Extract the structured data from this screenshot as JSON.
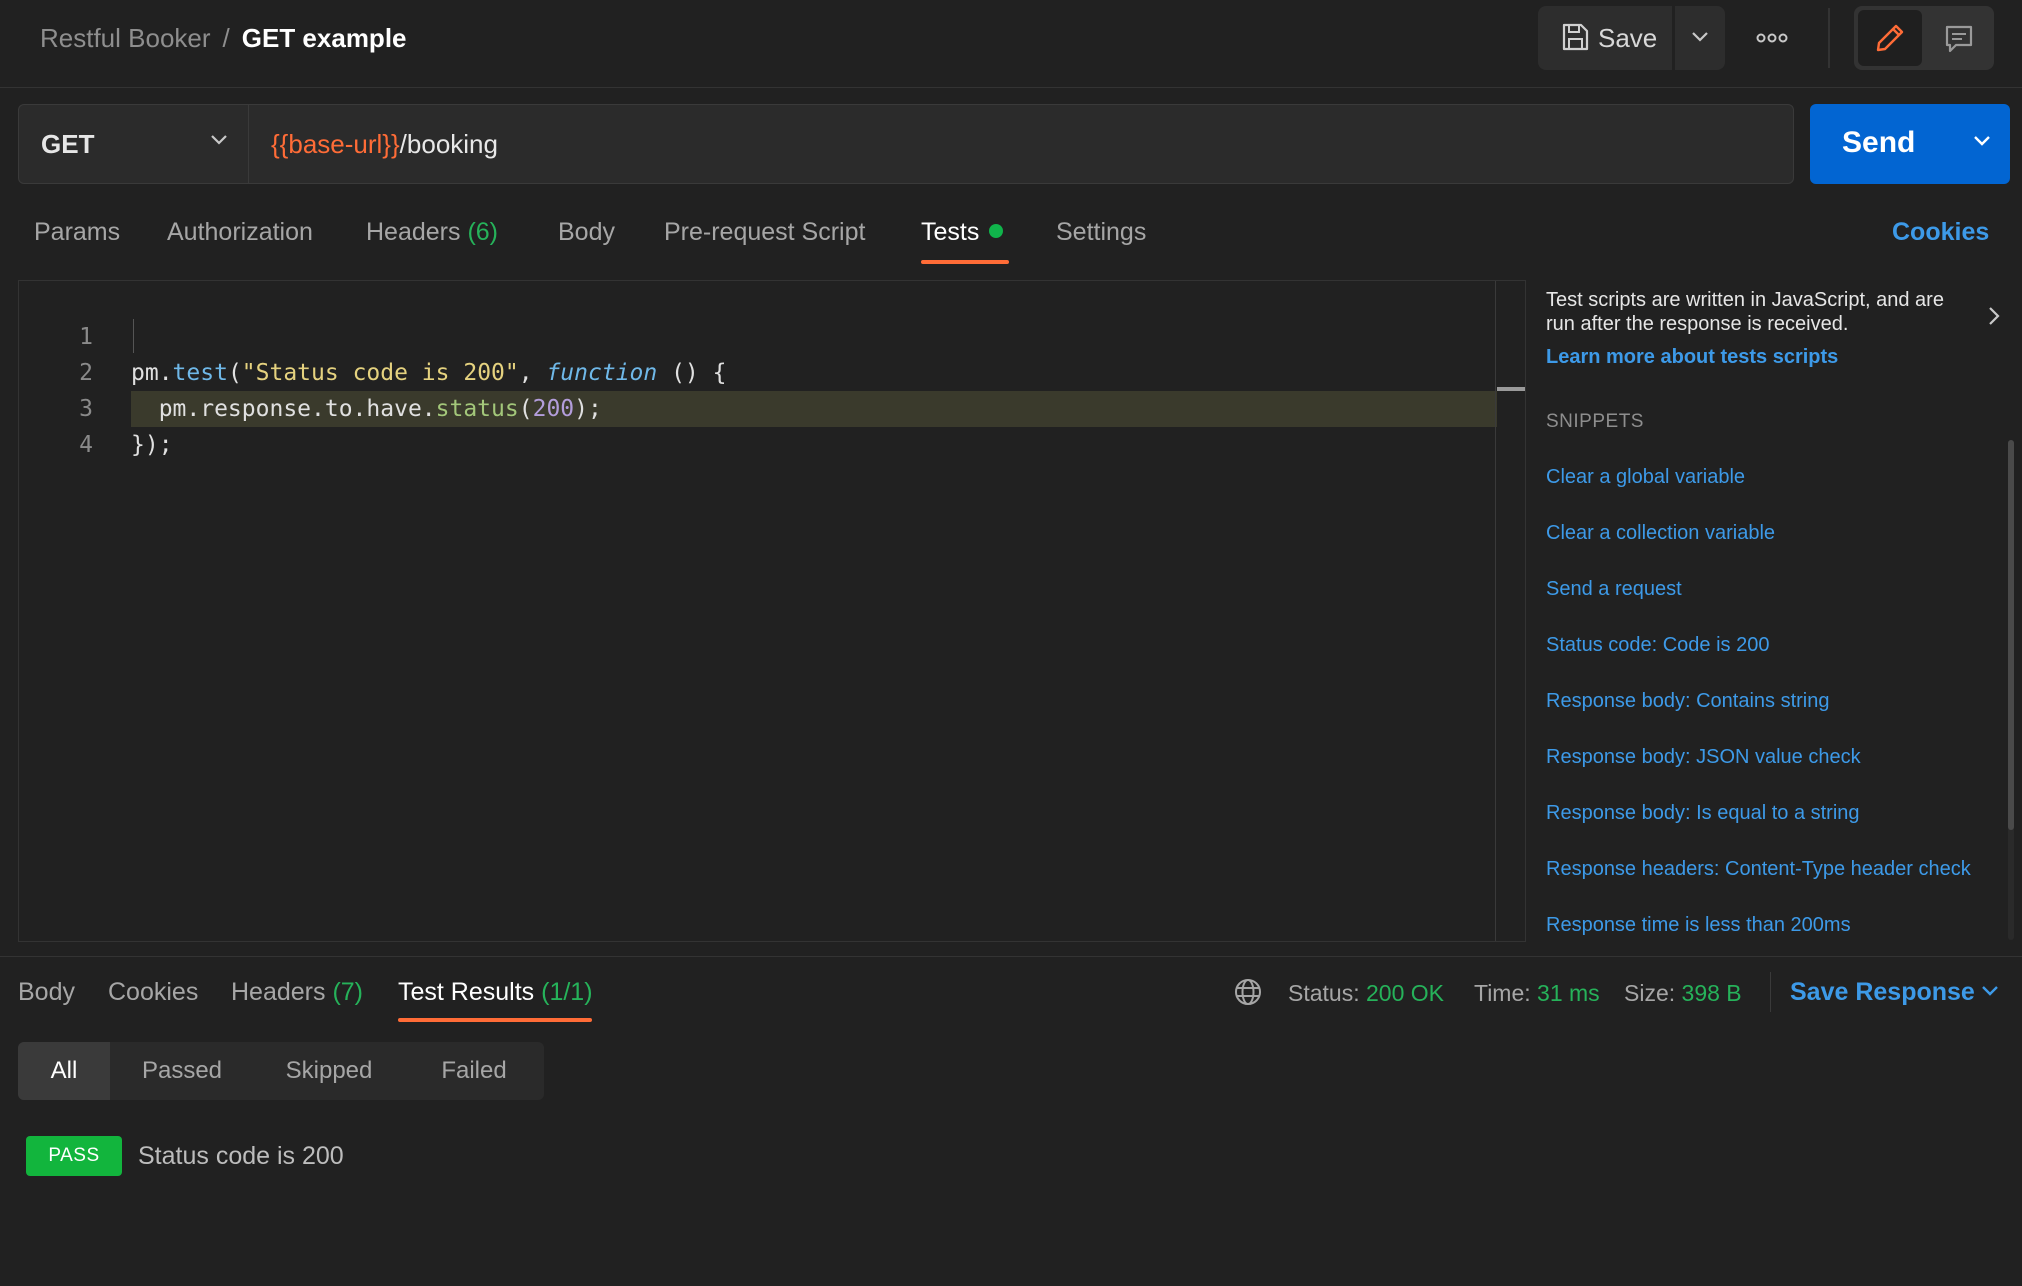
{
  "header": {
    "parent": "Restful Booker",
    "separator": "/",
    "current": "GET example",
    "save_label": "Save"
  },
  "request": {
    "method": "GET",
    "url_variable": "{{base-url}}",
    "url_path": "/booking",
    "send_label": "Send"
  },
  "tabs": {
    "params": "Params",
    "authorization": "Authorization",
    "headers": "Headers",
    "headers_count": "(6)",
    "body": "Body",
    "prerequest": "Pre-request Script",
    "tests": "Tests",
    "settings": "Settings",
    "cookies": "Cookies"
  },
  "editor": {
    "lines": [
      {
        "n": "1"
      },
      {
        "n": "2"
      },
      {
        "n": "3"
      },
      {
        "n": "4"
      }
    ],
    "l1": {
      "a": "pm.",
      "b": "test",
      "c": "(",
      "d": "\"Status code is 200\"",
      "e": ", ",
      "f": "function",
      "g": " () {"
    },
    "l2": {
      "a": "  pm.response.to.have.",
      "b": "status",
      "c": "(",
      "d": "200",
      "e": ");"
    },
    "l3": "});"
  },
  "sidebar": {
    "description": "Test scripts are written in JavaScript, and are run after the response is received.",
    "learn_more": "Learn more about tests scripts",
    "snippets_heading": "SNIPPETS",
    "snippets": [
      "Clear a global variable",
      "Clear a collection variable",
      "Send a request",
      "Status code: Code is 200",
      "Response body: Contains string",
      "Response body: JSON value check",
      "Response body: Is equal to a string",
      "Response headers: Content-Type header check",
      "Response time is less than 200ms"
    ]
  },
  "response": {
    "tabs": {
      "body": "Body",
      "cookies": "Cookies",
      "headers": "Headers",
      "headers_count": "(7)",
      "test_results": "Test Results",
      "test_results_count": "(1/1)"
    },
    "status_label": "Status:",
    "status_value": "200 OK",
    "time_label": "Time:",
    "time_value": "31 ms",
    "size_label": "Size:",
    "size_value": "398 B",
    "save_response": "Save Response",
    "filters": [
      "All",
      "Passed",
      "Skipped",
      "Failed"
    ],
    "results": [
      {
        "badge": "PASS",
        "name": "Status code is 200"
      }
    ]
  },
  "colors": {
    "accent": "#ff6c37",
    "primary": "#0265d2",
    "link": "#3d9ae8",
    "success": "#26b25a"
  }
}
